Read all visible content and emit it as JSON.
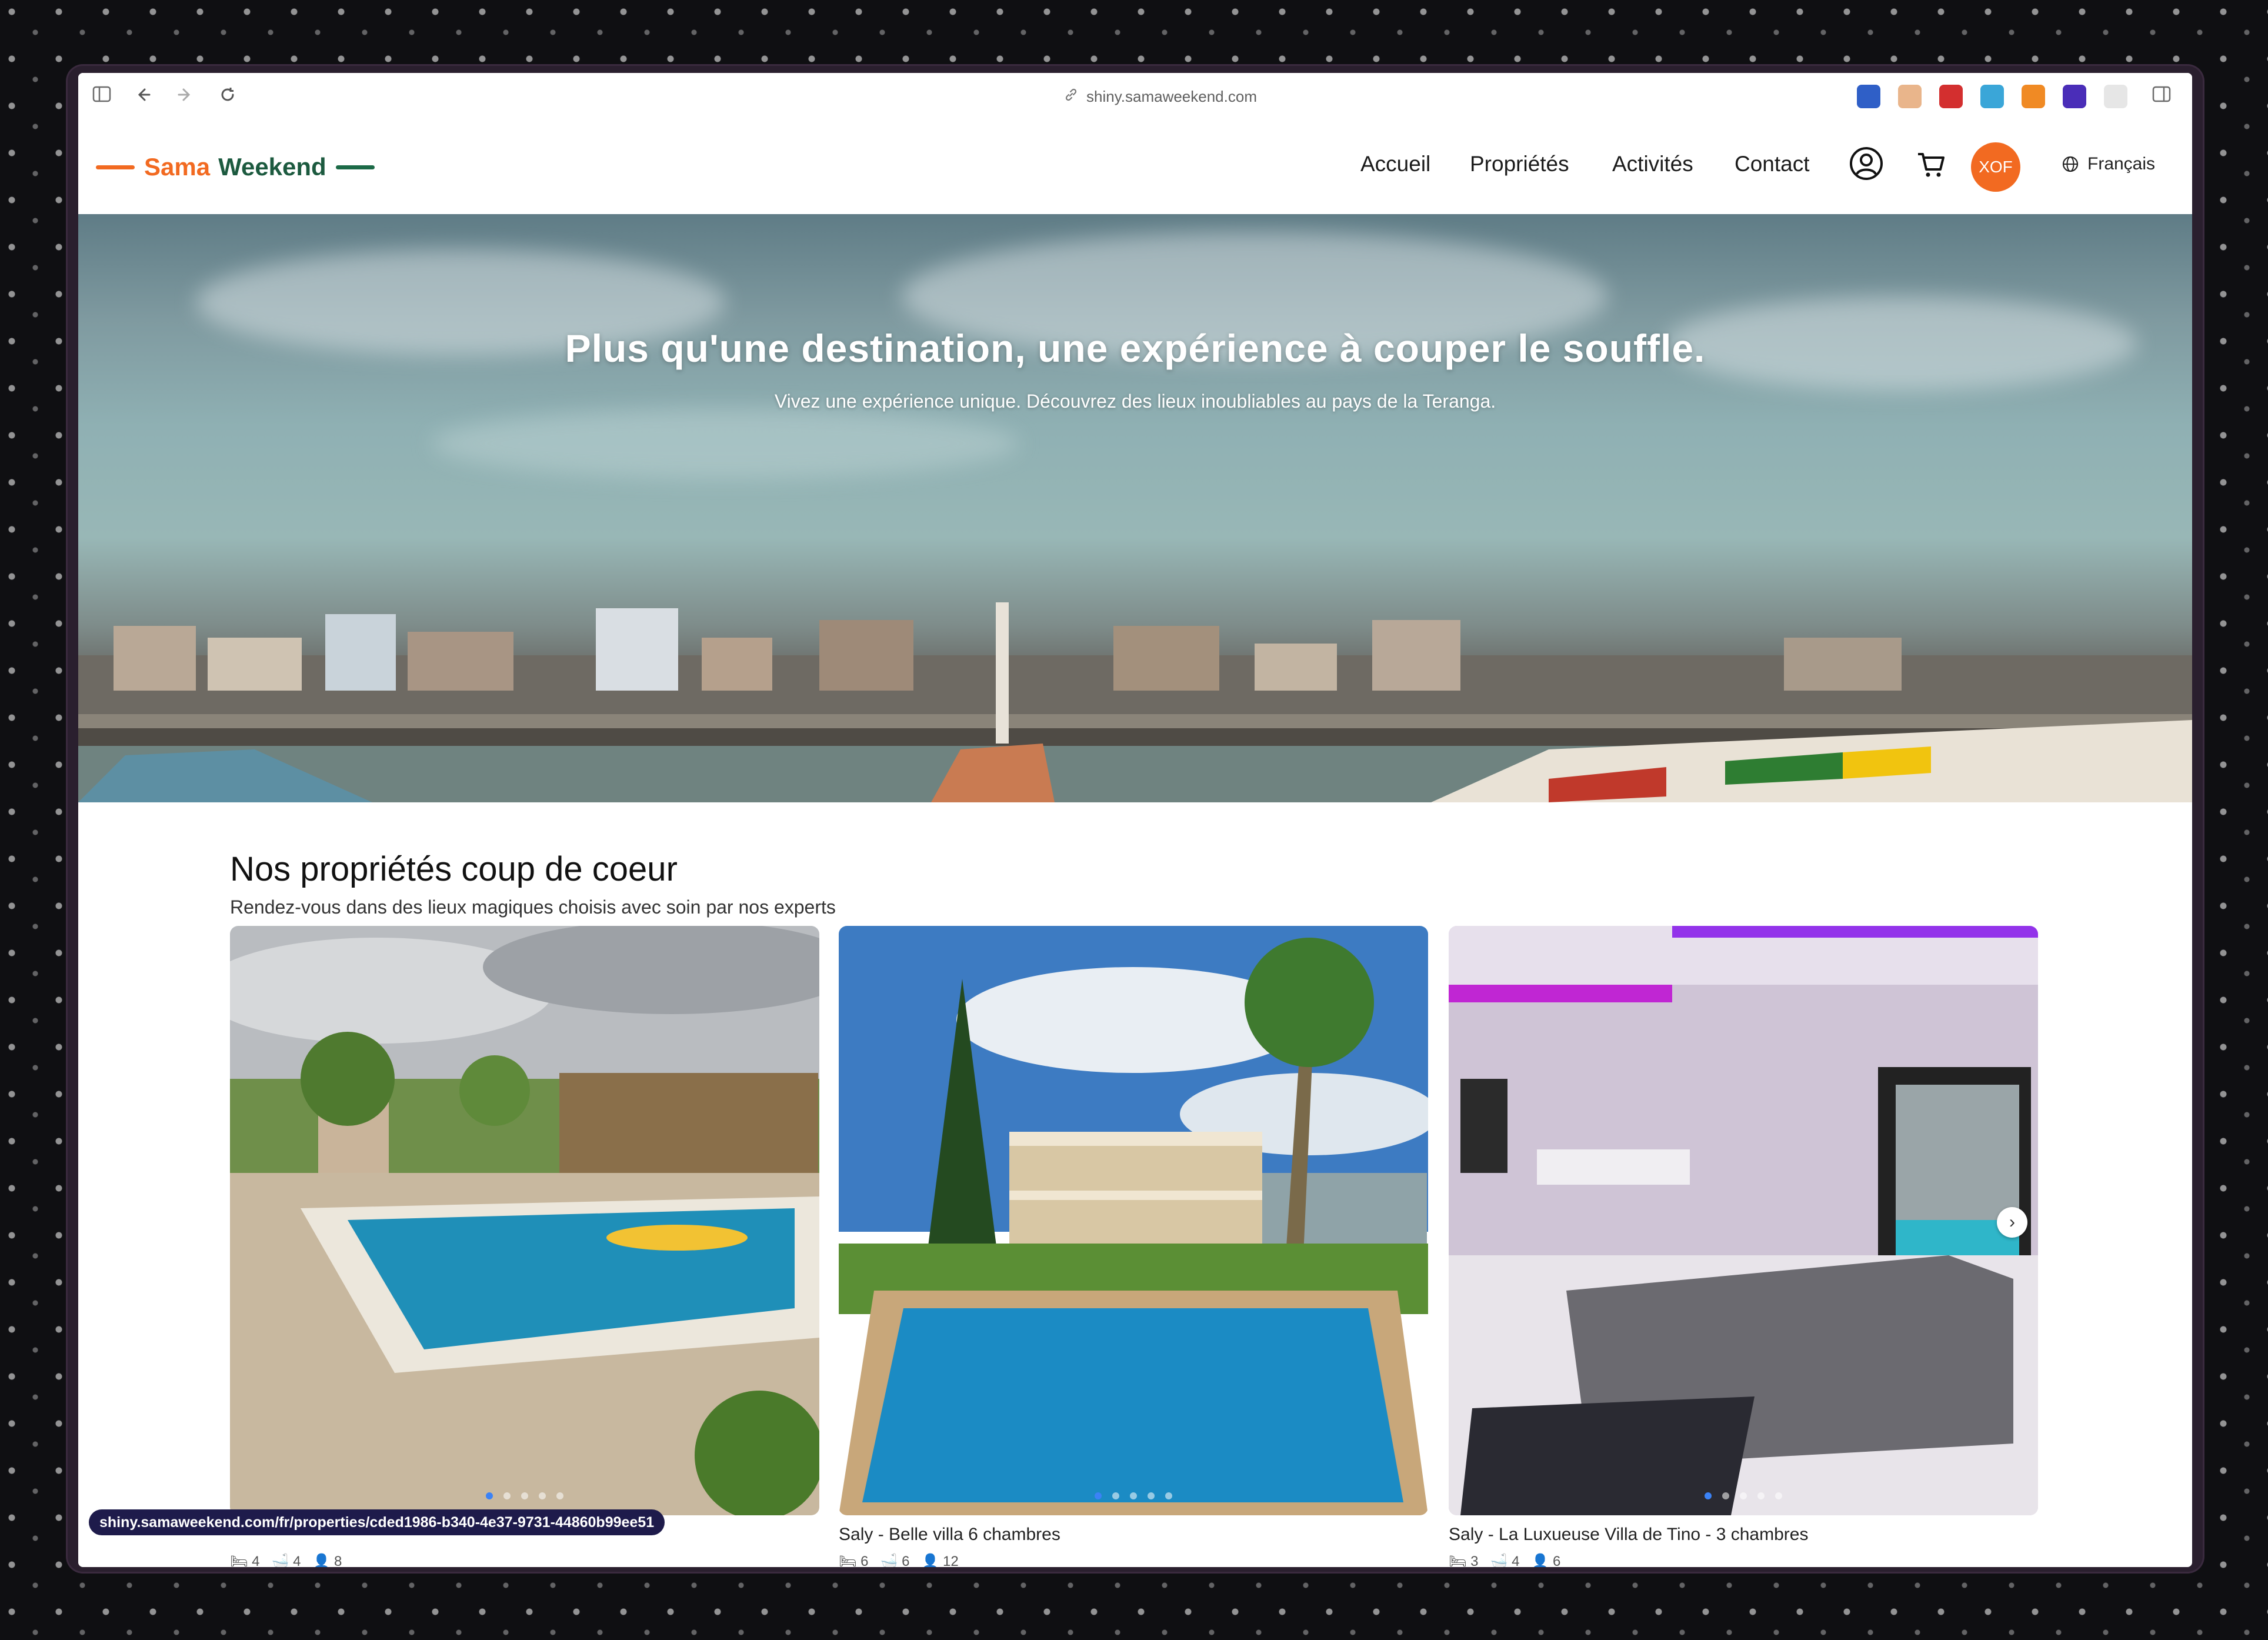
{
  "browser": {
    "url": "shiny.samaweekend.com",
    "status_url": "shiny.samaweekend.com/fr/properties/cded1986-b340-4e37-9731-44860b99ee51"
  },
  "header": {
    "logo_sama": "Sama",
    "logo_weekend": "Weekend",
    "nav": [
      "Accueil",
      "Propriétés",
      "Activités",
      "Contact"
    ],
    "currency": "XOF",
    "language": "Français"
  },
  "hero": {
    "title": "Plus qu'une destination, une expérience à couper le souffle.",
    "subtitle": "Vivez une expérience unique. Découvrez des lieux inoubliables au pays de la Teranga."
  },
  "section": {
    "title": "Nos propriétés coup de coeur",
    "subtitle": "Rendez-vous dans des lieux magiques choisis avec soin par nos experts"
  },
  "properties": [
    {
      "title": "",
      "beds": "4",
      "baths": "4",
      "guests": "8"
    },
    {
      "title": "Saly - Belle villa 6 chambres",
      "beds": "6",
      "baths": "6",
      "guests": "12"
    },
    {
      "title": "Saly - La Luxueuse Villa de Tino - 3 chambres",
      "beds": "3",
      "baths": "4",
      "guests": "6"
    }
  ],
  "colors": {
    "brand_orange": "#f26a21",
    "brand_green": "#1c5a3f",
    "carousel_active": "#3b82f6"
  }
}
